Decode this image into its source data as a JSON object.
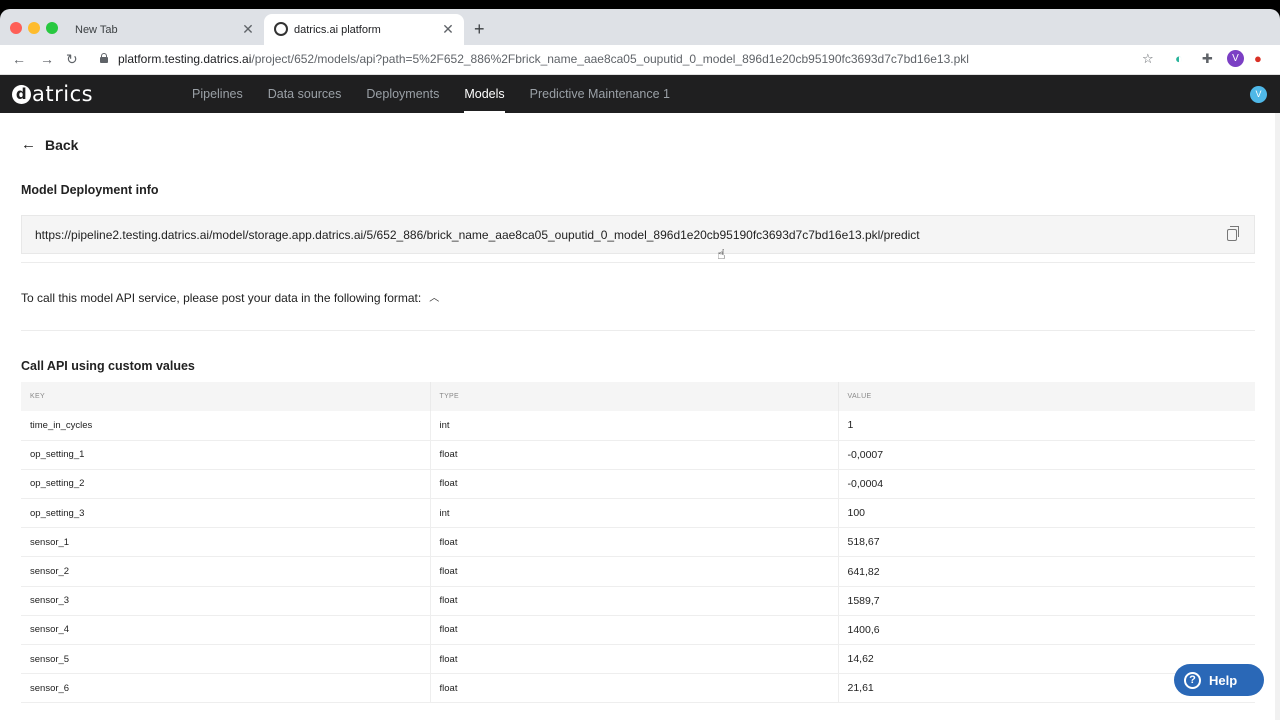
{
  "browser": {
    "tabs": [
      {
        "label": "New Tab"
      },
      {
        "label": "datrics.ai platform"
      }
    ],
    "url_host": "platform.testing.datrics.ai",
    "url_path": "/project/652/models/api?path=5%2F652_886%2Fbrick_name_aae8ca05_ouputid_0_model_896d1e20cb95190fc3693d7c7bd16e13.pkl",
    "profile_initial": "V"
  },
  "app": {
    "logo": "atrics",
    "logo_mark": "d",
    "nav": [
      "Pipelines",
      "Data sources",
      "Deployments",
      "Models",
      "Predictive Maintenance 1"
    ],
    "active_nav": "Models",
    "user_initial": "V"
  },
  "page": {
    "back_label": "Back",
    "deployment_title": "Model Deployment info",
    "endpoint_url": "https://pipeline2.testing.datrics.ai/model/storage.app.datrics.ai/5/652_886/brick_name_aae8ca05_ouputid_0_model_896d1e20cb95190fc3693d7c7bd16e13.pkl/predict",
    "format_text": "To call this model API service, please post your data in the following format:",
    "custom_title": "Call API using custom values",
    "table": {
      "headers": [
        "KEY",
        "TYPE",
        "VALUE"
      ],
      "rows": [
        {
          "key": "time_in_cycles",
          "type": "int",
          "value": "1"
        },
        {
          "key": "op_setting_1",
          "type": "float",
          "value": "-0,0007"
        },
        {
          "key": "op_setting_2",
          "type": "float",
          "value": "-0,0004"
        },
        {
          "key": "op_setting_3",
          "type": "int",
          "value": "100"
        },
        {
          "key": "sensor_1",
          "type": "float",
          "value": "518,67"
        },
        {
          "key": "sensor_2",
          "type": "float",
          "value": "641,82"
        },
        {
          "key": "sensor_3",
          "type": "float",
          "value": "1589,7"
        },
        {
          "key": "sensor_4",
          "type": "float",
          "value": "1400,6"
        },
        {
          "key": "sensor_5",
          "type": "float",
          "value": "14,62"
        },
        {
          "key": "sensor_6",
          "type": "float",
          "value": "21,61"
        }
      ]
    },
    "help_label": "Help"
  }
}
